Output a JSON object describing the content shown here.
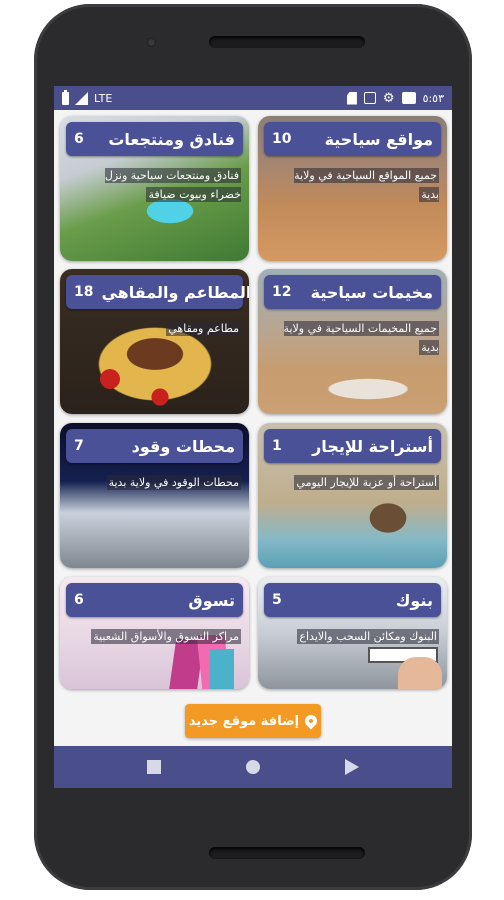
{
  "status_bar": {
    "network": "LTE",
    "time": "٥:٥٣"
  },
  "cards": [
    {
      "title": "مواقع سياحية",
      "count": "10",
      "description": "جميع المواقع السياحية في ولاية بدية",
      "image": "desert-dunes"
    },
    {
      "title": "فنادق ومنتجعات",
      "count": "6",
      "description": "فنادق ومنتجعات سياحية ونزل خضراء وبيوت ضيافة",
      "image": "resort-pool"
    },
    {
      "title": "مخيمات سياحية",
      "count": "12",
      "description": "جميع المخيمات السياحية في ولاية بدية",
      "image": "desert-camp"
    },
    {
      "title": "المطاعم والمقاهي",
      "count": "18",
      "description": "مطاعم ومقاهي",
      "image": "rice-meat-dish"
    },
    {
      "title": "أستراحة للإيجار",
      "count": "1",
      "description": "أستراحة أو عزبة للإيجار اليومي",
      "image": "rest-house-chairs"
    },
    {
      "title": "محطات وقود",
      "count": "7",
      "description": "محطات الوقود في ولاية بدية",
      "image": "fuel-station"
    },
    {
      "title": "بنوك",
      "count": "5",
      "description": "البنوك ومكائن السحب والايداع",
      "image": "atm-card"
    },
    {
      "title": "تسوق",
      "count": "6",
      "description": "مراكز التسوق والأسواق الشعبية",
      "image": "shopping-bags"
    }
  ],
  "add_button": {
    "label": "إضافة موقع جديد",
    "icon": "map-pin-icon"
  },
  "colors": {
    "primary": "#4a4f8c",
    "card_bar": "#4a5196",
    "accent": "#f39a25"
  }
}
